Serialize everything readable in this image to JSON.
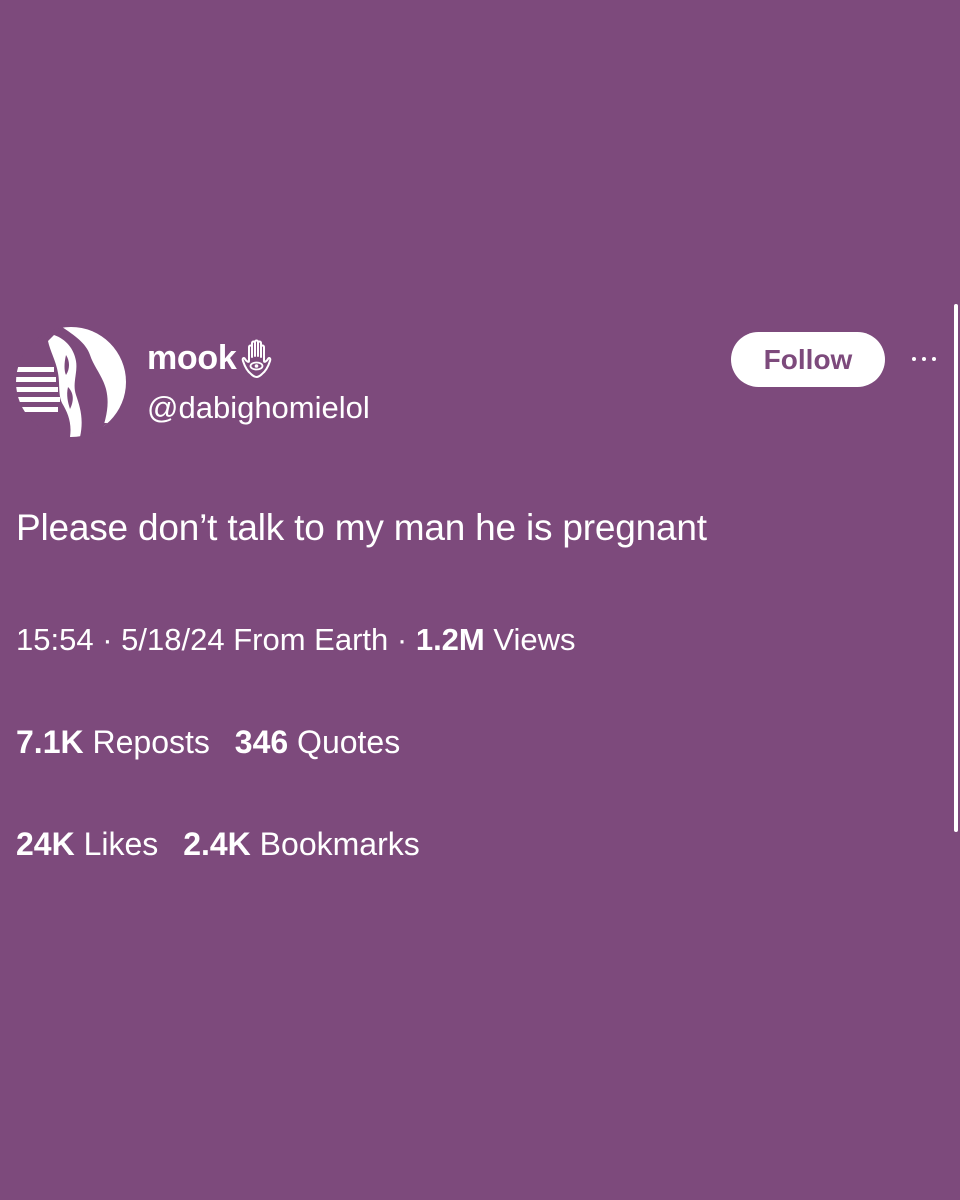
{
  "colors": {
    "background": "#7d4a7c",
    "text": "#ffffff",
    "button_bg": "#ffffff",
    "button_text": "#7d4a7c"
  },
  "author": {
    "display_name": "mook",
    "name_badge_icon": "hamsa-icon",
    "handle": "@dabighomielol",
    "avatar_icon": "avatar"
  },
  "actions": {
    "follow_label": "Follow",
    "more_icon": "more-options-icon"
  },
  "tweet": {
    "text": "Please don’t talk to my man he is pregnant",
    "time": "15:54",
    "separator": "·",
    "date": "5/18/24",
    "source": "From Earth",
    "views_count": "1.2M",
    "views_label": "Views"
  },
  "stats": {
    "reposts_count": "7.1K",
    "reposts_label": "Reposts",
    "quotes_count": "346",
    "quotes_label": "Quotes",
    "likes_count": "24K",
    "likes_label": "Likes",
    "bookmarks_count": "2.4K",
    "bookmarks_label": "Bookmarks"
  }
}
